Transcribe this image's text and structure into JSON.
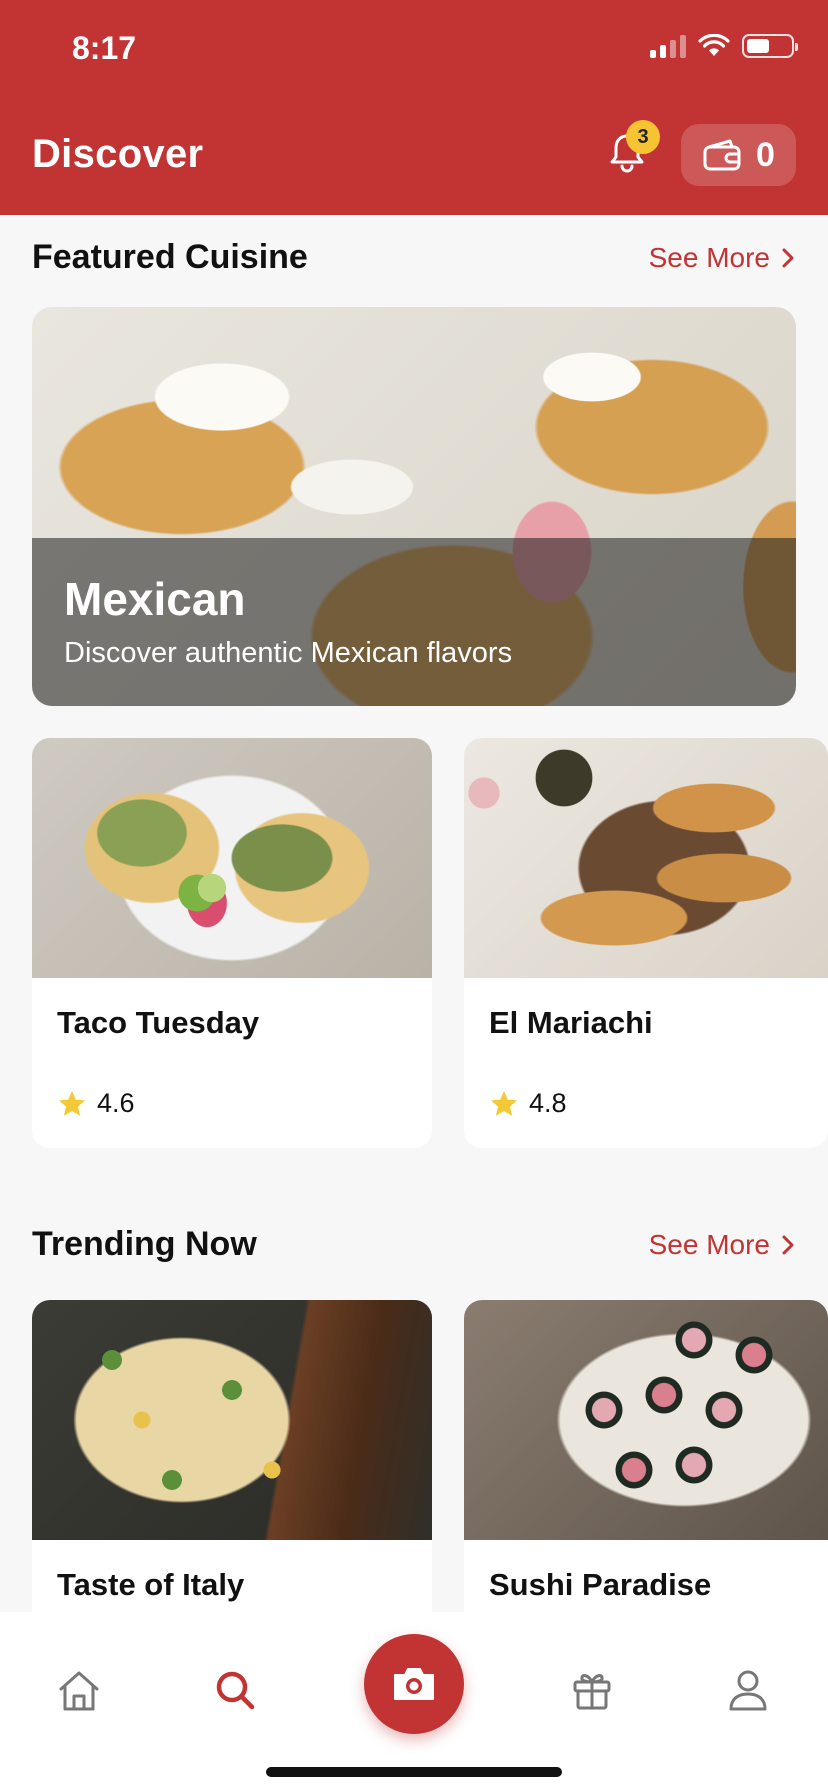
{
  "status_bar": {
    "time": "8:17"
  },
  "header": {
    "title": "Discover",
    "notification_count": "3",
    "wallet_count": "0",
    "accent_color": "#c23434",
    "badge_color": "#f6c433"
  },
  "featured": {
    "section_title": "Featured Cuisine",
    "see_more": "See More",
    "hero": {
      "title": "Mexican",
      "subtitle": "Discover authentic Mexican flavors"
    },
    "cards": [
      {
        "name": "Taco Tuesday",
        "rating": "4.6"
      },
      {
        "name": "El Mariachi",
        "rating": "4.8"
      }
    ]
  },
  "trending": {
    "section_title": "Trending Now",
    "see_more": "See More",
    "cards": [
      {
        "name": "Taste of Italy"
      },
      {
        "name": "Sushi Paradise"
      }
    ]
  },
  "bottom_nav": {
    "items": [
      {
        "icon": "home-icon",
        "active": false
      },
      {
        "icon": "search-icon",
        "active": true
      },
      {
        "icon": "camera-icon",
        "active": false
      },
      {
        "icon": "gift-icon",
        "active": false
      },
      {
        "icon": "profile-icon",
        "active": false
      }
    ]
  }
}
